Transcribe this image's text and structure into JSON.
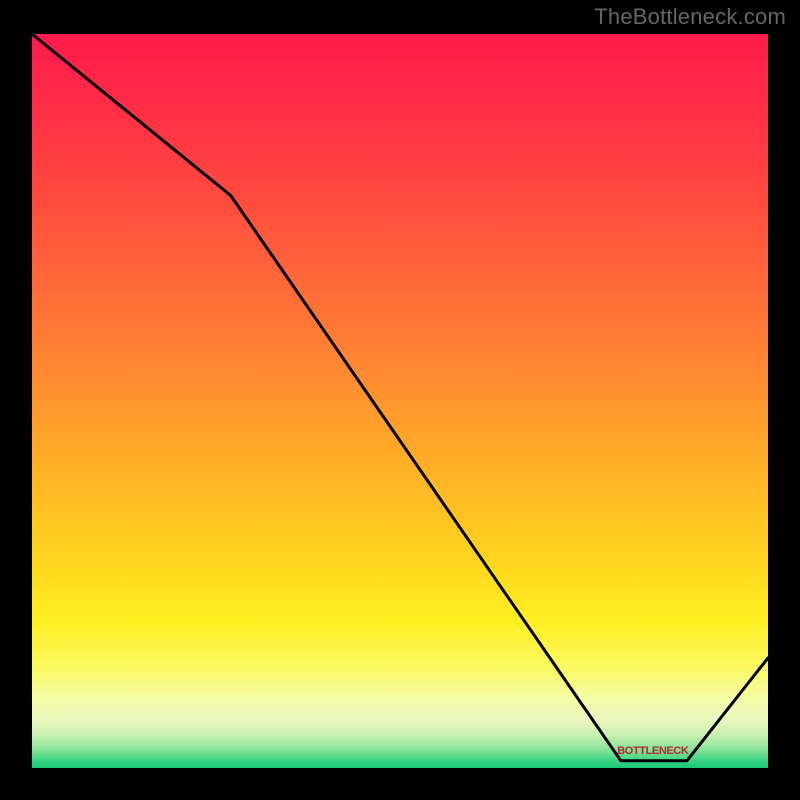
{
  "watermark": "TheBottleneck.com",
  "chart_data": {
    "type": "line",
    "title": "",
    "xlabel": "",
    "ylabel": "",
    "xlim": [
      0,
      100
    ],
    "ylim": [
      0,
      100
    ],
    "grid": false,
    "series": [
      {
        "name": "bottleneck-curve",
        "x": [
          0,
          27,
          80,
          89,
          100
        ],
        "y": [
          100,
          78,
          1,
          1,
          15
        ]
      }
    ],
    "annotations": [
      {
        "name": "bottleneck-label",
        "text": "BOTTLENECK",
        "x": 84,
        "y": 2
      }
    ],
    "gradient_stops": [
      {
        "offset": 0.0,
        "color": "#ff1a4b"
      },
      {
        "offset": 0.1,
        "color": "#ff2d47"
      },
      {
        "offset": 0.22,
        "color": "#ff4a3f"
      },
      {
        "offset": 0.35,
        "color": "#ff6b38"
      },
      {
        "offset": 0.48,
        "color": "#ff8f30"
      },
      {
        "offset": 0.6,
        "color": "#ffb325"
      },
      {
        "offset": 0.72,
        "color": "#ffd61e"
      },
      {
        "offset": 0.8,
        "color": "#ffef22"
      },
      {
        "offset": 0.86,
        "color": "#fbf85e"
      },
      {
        "offset": 0.905,
        "color": "#f6fca6"
      },
      {
        "offset": 0.935,
        "color": "#eaf8c0"
      },
      {
        "offset": 0.955,
        "color": "#c9efb0"
      },
      {
        "offset": 0.975,
        "color": "#88e39a"
      },
      {
        "offset": 0.99,
        "color": "#3bd382"
      },
      {
        "offset": 1.0,
        "color": "#18c878"
      }
    ]
  }
}
